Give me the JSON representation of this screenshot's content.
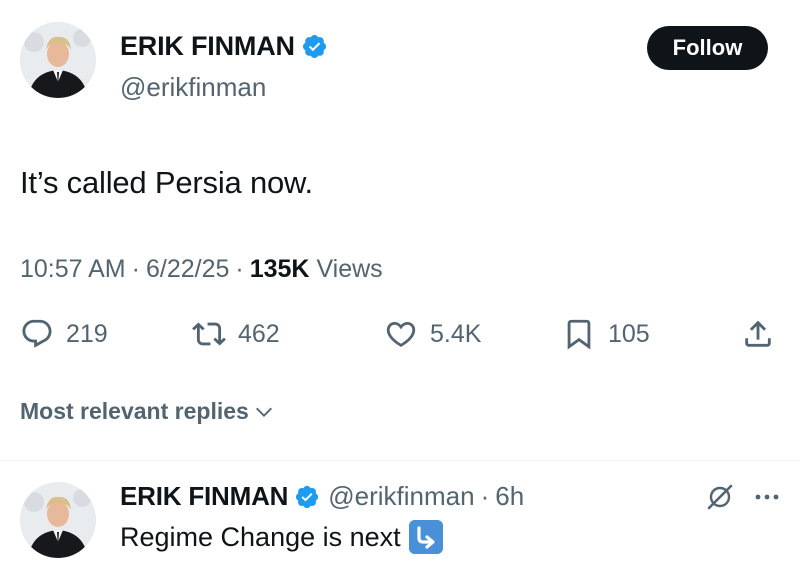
{
  "tweet": {
    "author": {
      "display_name": "ERIK FINMAN",
      "handle": "@erikfinman",
      "verified": true
    },
    "follow_label": "Follow",
    "text": "It’s called Persia now.",
    "time": "10:57 AM",
    "date": "6/22/25",
    "views_count": "135K",
    "views_label": "Views",
    "separator": "·",
    "stats": {
      "replies": "219",
      "retweets": "462",
      "likes": "5.4K",
      "bookmarks": "105"
    }
  },
  "replies_sort": {
    "label": "Most relevant replies",
    "icon": "chevron-down-icon"
  },
  "reply": {
    "author": {
      "display_name": "ERIK FINMAN",
      "handle": "@erikfinman",
      "verified": true
    },
    "separator": "·",
    "time_ago": "6h",
    "text": "Regime Change is next",
    "emoji": "arrow-down-right-emoji"
  },
  "colors": {
    "text_primary": "#0f1419",
    "text_secondary": "#536471",
    "verified_blue": "#1d9bf0",
    "follow_bg": "#0f1419",
    "divider": "#eff3f4"
  }
}
